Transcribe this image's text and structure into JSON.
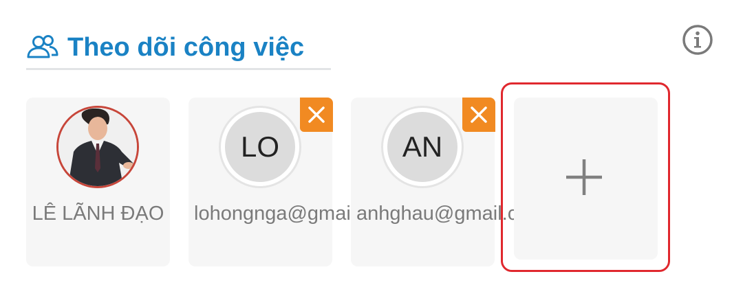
{
  "header": {
    "title": "Theo dõi công việc",
    "icon": "users-icon",
    "accent_color": "#1a82c4"
  },
  "info_icon": "info-icon",
  "followers": [
    {
      "type": "photo",
      "name": "LÊ LÃNH ĐẠO",
      "removable": false
    },
    {
      "type": "initials",
      "initials": "LO",
      "name": "lohongnga@gmail.c…",
      "removable": true
    },
    {
      "type": "initials",
      "initials": "AN",
      "name": "anhghau@gmail.c…",
      "removable": true
    }
  ],
  "add_button": {
    "icon": "plus-icon",
    "highlight_color": "#e0282e"
  },
  "remove_button_color": "#f18a22"
}
